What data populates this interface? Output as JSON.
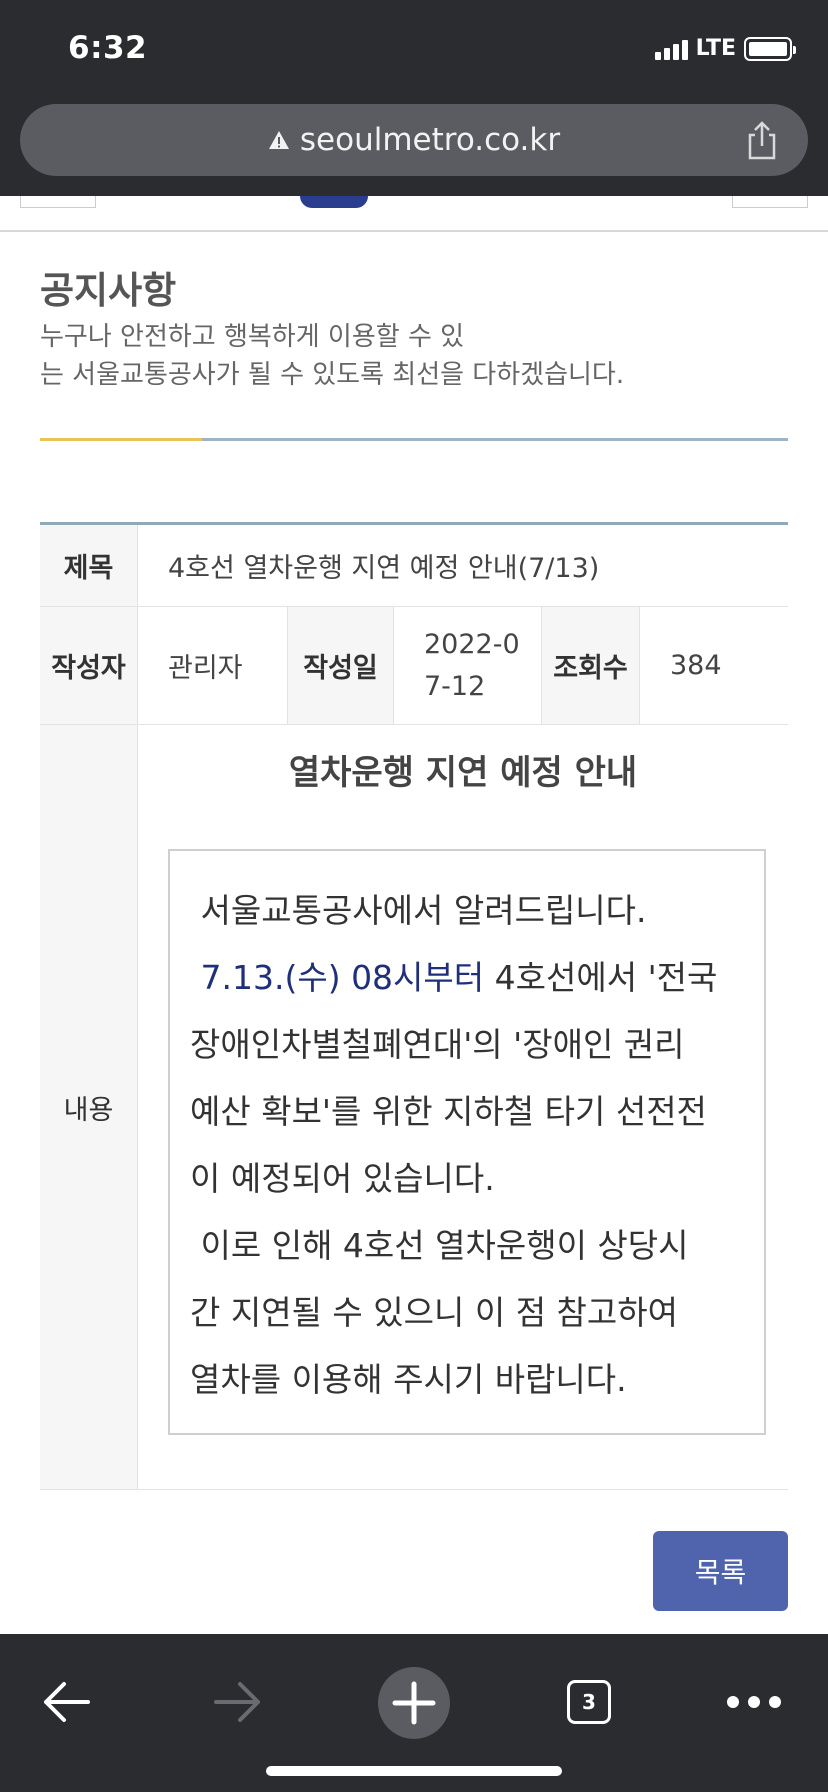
{
  "status_bar": {
    "time": "6:32",
    "network": "LTE",
    "battery_level": 1.0
  },
  "browser": {
    "url": "seoulmetro.co.kr",
    "tab_count": "3"
  },
  "page": {
    "title": "공지사항",
    "description_line1": "누구나 안전하고 행복하게 이용할 수 있",
    "description_line2": "는 서울교통공사가 될 수 있도록 최선을 다하겠습니다."
  },
  "notice": {
    "title_label": "제목",
    "title_value": "4호선 열차운행 지연 예정 안내(7/13)",
    "author_label": "작성자",
    "author_value": "관리자",
    "date_label": "작성일",
    "date_value_line1": "2022-0",
    "date_value_line2": "7-12",
    "views_label": "조회수",
    "views_value": "384",
    "content_label": "내용",
    "content_heading": "열차운행 지연 예정 안내",
    "content_lines": [
      " 서울교통공사에서 알려드립니다.",
      "4호선에서 '전국",
      "장애인차별철폐연대'의 '장애인 권리",
      "예산 확보'를 위한 지하철 타기 선전전",
      "이 예정되어 있습니다.",
      " 이로 인해 4호선 열차운행이 상당시",
      "간 지연될 수 있으니 이 점 참고하여",
      "열차를 이용해 주시기 바랍니다."
    ],
    "highlight": " 7.13.(수) 08시부터 "
  },
  "list_button_label": "목록",
  "colors": {
    "browser_chrome": "#2b2c30",
    "url_pill": "#5b5c61",
    "table_top_border": "#8fa9b8",
    "title_rule_accent": "#e7c35a",
    "highlight_text": "#1f2f7a",
    "list_button": "#4f64ad"
  },
  "icons": {
    "warning": "warning-triangle-icon",
    "share": "share-icon",
    "back": "back-arrow-icon",
    "forward": "forward-arrow-icon",
    "new_tab": "plus-icon",
    "tabs": "tab-count-icon",
    "more": "more-dots-icon"
  }
}
